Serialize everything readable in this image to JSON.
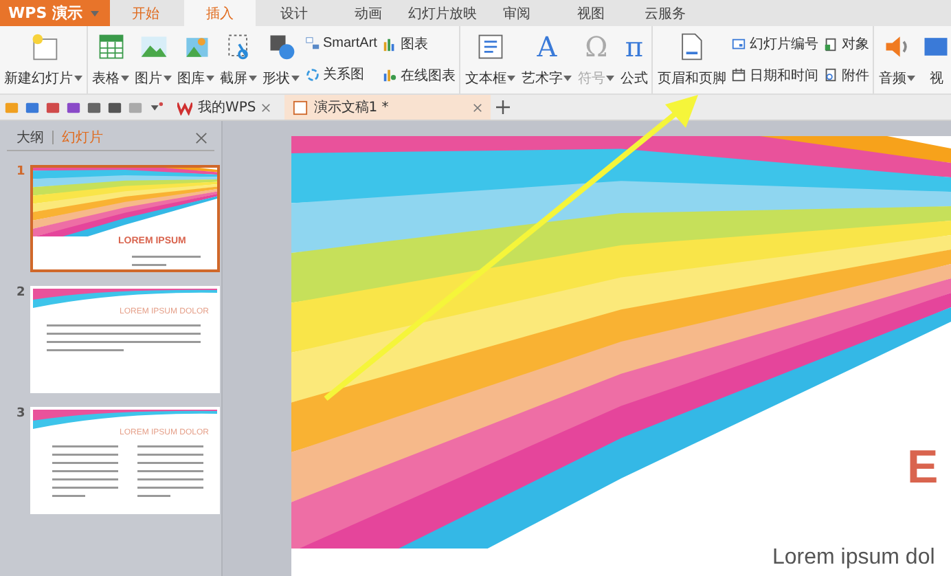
{
  "app_menu": {
    "label": "WPS 演示"
  },
  "menu_tabs": [
    {
      "label": "开始",
      "selected": false
    },
    {
      "label": "插入",
      "selected": true
    },
    {
      "label": "设计",
      "selected": false
    },
    {
      "label": "动画",
      "selected": false
    },
    {
      "label": "幻灯片放映",
      "selected": false
    },
    {
      "label": "审阅",
      "selected": false
    },
    {
      "label": "视图",
      "selected": false
    },
    {
      "label": "云服务",
      "selected": false
    }
  ],
  "ribbon": {
    "groups": [
      {
        "columns": [
          {
            "kind": "large",
            "items": [
              {
                "label": "新建幻灯片",
                "dropdown": true,
                "disabled": false
              }
            ]
          }
        ]
      },
      {
        "columns": [
          {
            "kind": "large",
            "items": [
              {
                "label": "表格",
                "dropdown": true,
                "disabled": false
              }
            ]
          },
          {
            "kind": "large",
            "items": [
              {
                "label": "图片",
                "dropdown": true,
                "disabled": false
              }
            ]
          },
          {
            "kind": "large",
            "items": [
              {
                "label": "图库",
                "dropdown": true,
                "disabled": false
              }
            ]
          },
          {
            "kind": "large",
            "items": [
              {
                "label": "截屏",
                "dropdown": true,
                "disabled": false
              }
            ]
          },
          {
            "kind": "large",
            "items": [
              {
                "label": "形状",
                "dropdown": true,
                "disabled": false
              }
            ]
          },
          {
            "kind": "stack",
            "items": [
              {
                "label": "SmartArt",
                "dropdown": false,
                "disabled": false
              },
              {
                "label": "关系图",
                "dropdown": false,
                "disabled": false
              }
            ]
          },
          {
            "kind": "stack",
            "items": [
              {
                "label": "图表",
                "dropdown": false,
                "disabled": false
              },
              {
                "label": "在线图表",
                "dropdown": false,
                "disabled": false
              }
            ]
          }
        ]
      },
      {
        "columns": [
          {
            "kind": "large",
            "items": [
              {
                "label": "文本框",
                "dropdown": true,
                "disabled": false
              }
            ]
          },
          {
            "kind": "large",
            "items": [
              {
                "label": "艺术字",
                "dropdown": true,
                "disabled": false,
                "glyph": "A"
              }
            ]
          },
          {
            "kind": "large",
            "items": [
              {
                "label": "符号",
                "dropdown": true,
                "disabled": true,
                "glyph": "Ω"
              }
            ]
          },
          {
            "kind": "large",
            "items": [
              {
                "label": "公式",
                "dropdown": false,
                "disabled": false,
                "glyph": "π"
              }
            ]
          }
        ]
      },
      {
        "columns": [
          {
            "kind": "large",
            "items": [
              {
                "label": "页眉和页脚",
                "dropdown": false,
                "disabled": false
              }
            ]
          },
          {
            "kind": "stack",
            "items": [
              {
                "label": "幻灯片编号",
                "dropdown": false,
                "disabled": false
              },
              {
                "label": "日期和时间",
                "dropdown": false,
                "disabled": false
              }
            ]
          },
          {
            "kind": "stack",
            "items": [
              {
                "label": "对象",
                "dropdown": false,
                "disabled": false
              },
              {
                "label": "附件",
                "dropdown": false,
                "disabled": false
              }
            ]
          }
        ]
      },
      {
        "columns": [
          {
            "kind": "large",
            "items": [
              {
                "label": "音频",
                "dropdown": true,
                "disabled": false
              }
            ]
          },
          {
            "kind": "large",
            "items": [
              {
                "label": "视",
                "dropdown": false,
                "disabled": false
              }
            ]
          }
        ]
      }
    ]
  },
  "doc_tabs": [
    {
      "label": "我的WPS",
      "selected": false
    },
    {
      "label": "演示文稿1 *",
      "selected": true
    }
  ],
  "panel": {
    "tabs": [
      {
        "label": "大纲",
        "selected": false
      },
      {
        "label": "幻灯片",
        "selected": true
      }
    ],
    "slides": [
      {
        "number": "1",
        "selected": true,
        "kind": "title",
        "title": "LOREM IPSUM"
      },
      {
        "number": "2",
        "selected": false,
        "kind": "bullets",
        "title": "LOREM IPSUM DOLOR"
      },
      {
        "number": "3",
        "selected": false,
        "kind": "two_column",
        "title": "LOREM IPSUM DOLOR"
      }
    ]
  },
  "slide": {
    "title": "E",
    "subtitle": "Lorem ipsum dol"
  }
}
